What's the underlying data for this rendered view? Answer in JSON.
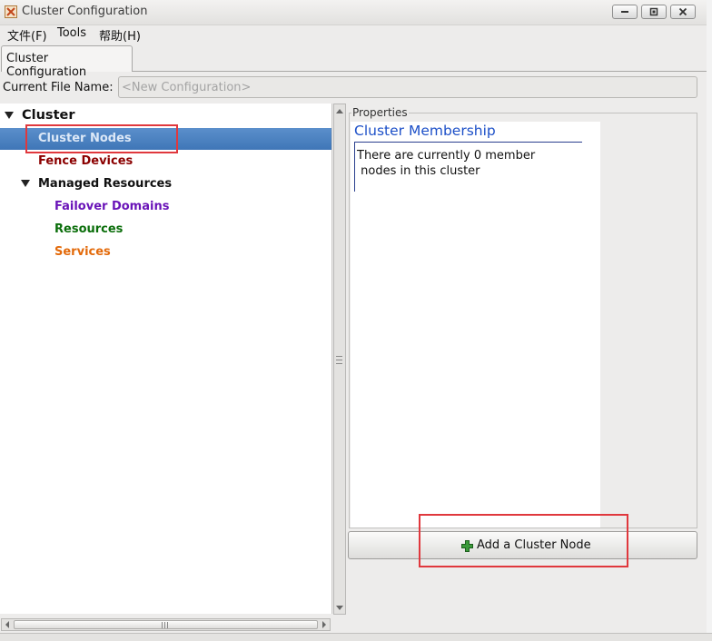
{
  "window": {
    "title": "Cluster Configuration"
  },
  "menubar": {
    "items": [
      "文件(F)",
      "Tools",
      "帮助(H)"
    ]
  },
  "tabs": [
    {
      "label": "Cluster Configuration",
      "active": true
    }
  ],
  "file_name": {
    "label": "Current File Name:",
    "placeholder": "<New Configuration>"
  },
  "tree": {
    "root": "Cluster",
    "items": [
      {
        "label": "Cluster Nodes",
        "color": "#ffffff",
        "selected": true
      },
      {
        "label": "Fence Devices",
        "color": "#8b0000"
      },
      {
        "label": "Managed Resources",
        "color": "#111111"
      },
      {
        "label": "Failover Domains",
        "color": "#6a14b8"
      },
      {
        "label": "Resources",
        "color": "#0b6e0b"
      },
      {
        "label": "Services",
        "color": "#e36a0a"
      }
    ]
  },
  "properties": {
    "label": "Properties",
    "heading": "Cluster Membership",
    "text_line1": "There are currently 0 member",
    "text_line2": " nodes in this cluster",
    "heading_color": "#1d50c8"
  },
  "add_button": {
    "label": "Add a Cluster Node",
    "icon": "plus-icon"
  },
  "colors": {
    "highlight": "#e0383d",
    "selection": "#4a7fbf"
  }
}
